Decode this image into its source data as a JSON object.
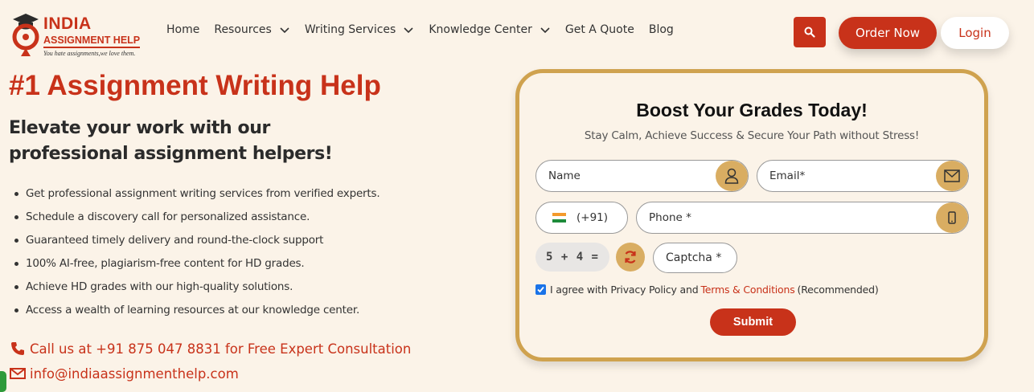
{
  "brand": {
    "name_line1": "INDIA",
    "name_line2": "ASSIGNMENT HELP",
    "tagline": "You hate assignments,we love them.",
    "accent_color": "#c8321a",
    "gold_color": "#cfa24f"
  },
  "nav": {
    "items": [
      {
        "label": "Home",
        "has_dropdown": false
      },
      {
        "label": "Resources",
        "has_dropdown": true
      },
      {
        "label": "Writing Services",
        "has_dropdown": true
      },
      {
        "label": "Knowledge Center",
        "has_dropdown": true
      },
      {
        "label": "Get A Quote",
        "has_dropdown": false
      },
      {
        "label": "Blog",
        "has_dropdown": false
      }
    ],
    "search_icon": "search-icon",
    "order_label": "Order Now",
    "login_label": "Login"
  },
  "hero": {
    "title": "#1 Assignment Writing Help",
    "subtitle": "Elevate your work with our professional assignment helpers!",
    "features": [
      "Get professional assignment writing services from verified experts.",
      "Schedule a discovery call for personalized assistance.",
      "Guaranteed timely delivery and round-the-clock support",
      "100% AI-free, plagiarism-free content for HD grades.",
      "Achieve HD grades with our high-quality solutions.",
      "Access a wealth of learning resources at our knowledge center."
    ],
    "call_text": "Call us at +91 875 047 8831 for Free Expert Consultation",
    "email_text": "info@indiaassignmenthelp.com"
  },
  "form": {
    "title": "Boost Your Grades Today!",
    "subtitle": "Stay Calm, Achieve Success & Secure Your Path without Stress!",
    "name_placeholder": "Name",
    "email_placeholder": "Email*",
    "country_code": "(+91)",
    "phone_placeholder": "Phone *",
    "captcha_image_text": "5 + 4 =",
    "captcha_placeholder": "Captcha *",
    "agree_prefix": "I agree with Privacy Policy and",
    "agree_link": "Terms & Conditions",
    "agree_suffix": "(Recommended)",
    "agree_checked": true,
    "submit_label": "Submit"
  }
}
